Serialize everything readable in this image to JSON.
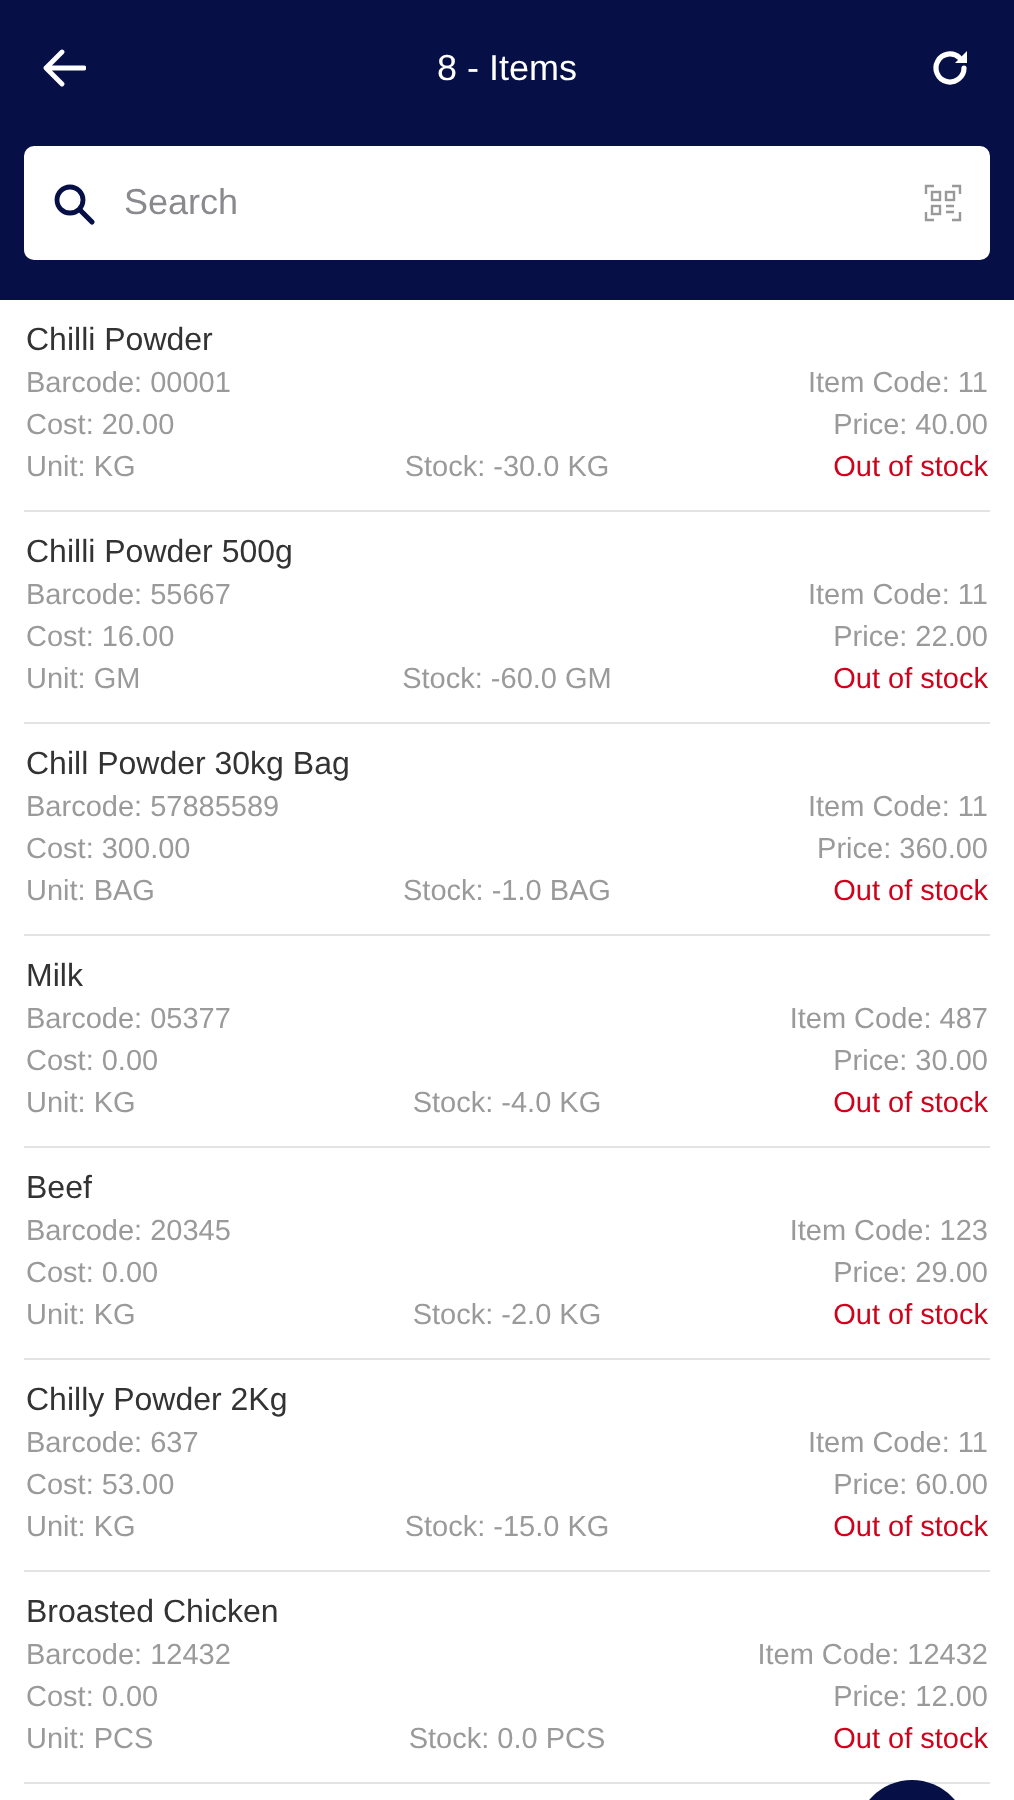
{
  "header": {
    "title": "8 - Items"
  },
  "search": {
    "placeholder": "Search"
  },
  "items": [
    {
      "name": "Chilli Powder",
      "barcode": "Barcode: 00001",
      "item_code": "Item Code: 11",
      "cost": "Cost: 20.00",
      "price": "Price: 40.00",
      "unit": "Unit: KG",
      "stock": "Stock: -30.0 KG",
      "status": "Out of stock",
      "in_stock": false
    },
    {
      "name": "Chilli Powder 500g",
      "barcode": "Barcode: 55667",
      "item_code": "Item Code: 11",
      "cost": "Cost: 16.00",
      "price": "Price: 22.00",
      "unit": "Unit: GM",
      "stock": "Stock: -60.0 GM",
      "status": "Out of stock",
      "in_stock": false
    },
    {
      "name": "Chill Powder 30kg Bag",
      "barcode": "Barcode: 57885589",
      "item_code": "Item Code: 11",
      "cost": "Cost: 300.00",
      "price": "Price: 360.00",
      "unit": "Unit: BAG",
      "stock": "Stock: -1.0 BAG",
      "status": "Out of stock",
      "in_stock": false
    },
    {
      "name": "Milk",
      "barcode": "Barcode: 05377",
      "item_code": "Item Code: 487",
      "cost": "Cost: 0.00",
      "price": "Price: 30.00",
      "unit": "Unit: KG",
      "stock": "Stock: -4.0 KG",
      "status": "Out of stock",
      "in_stock": false
    },
    {
      "name": "Beef",
      "barcode": "Barcode: 20345",
      "item_code": "Item Code: 123",
      "cost": "Cost: 0.00",
      "price": "Price: 29.00",
      "unit": "Unit: KG",
      "stock": "Stock: -2.0 KG",
      "status": "Out of stock",
      "in_stock": false
    },
    {
      "name": "Chilly Powder 2Kg",
      "barcode": "Barcode: 637",
      "item_code": "Item Code: 11",
      "cost": "Cost: 53.00",
      "price": "Price: 60.00",
      "unit": "Unit: KG",
      "stock": "Stock: -15.0 KG",
      "status": "Out of stock",
      "in_stock": false
    },
    {
      "name": "Broasted Chicken",
      "barcode": "Barcode: 12432",
      "item_code": "Item Code: 12432",
      "cost": "Cost: 0.00",
      "price": "Price: 12.00",
      "unit": "Unit: PCS",
      "stock": "Stock: 0.0 PCS",
      "status": "Out of stock",
      "in_stock": false
    }
  ]
}
